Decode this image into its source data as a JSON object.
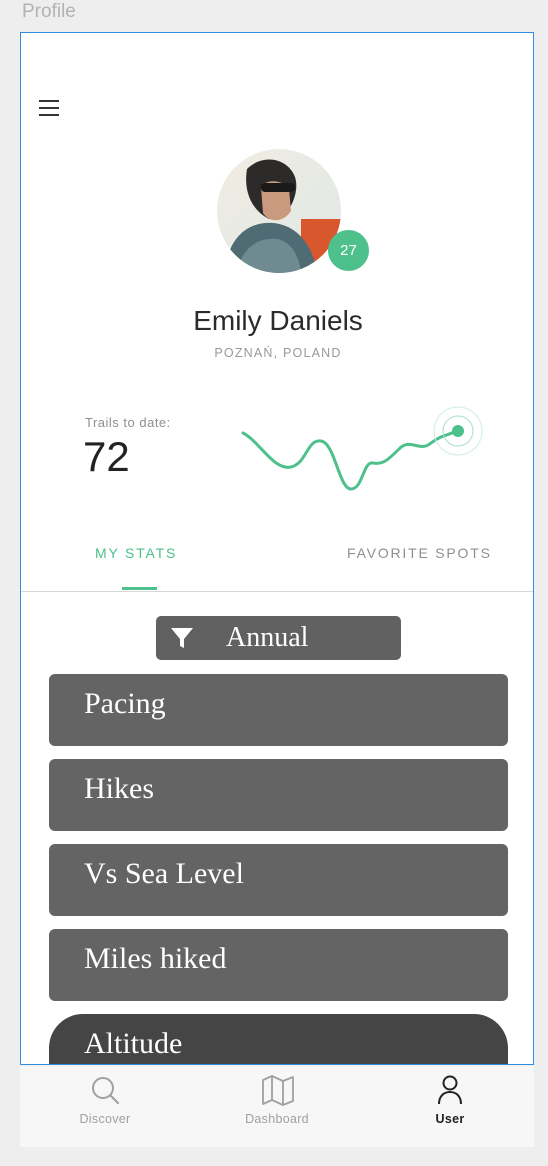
{
  "page_label": "Profile",
  "profile": {
    "name": "Emily Daniels",
    "location": "POZNAŃ, POLAND",
    "badge_count": "27"
  },
  "trails": {
    "label": "Trails to date:",
    "count": "72"
  },
  "tabs": [
    {
      "label": "MY STATS",
      "active": true
    },
    {
      "label": "FAVORITE SPOTS",
      "active": false
    }
  ],
  "filter": {
    "label": "Annual",
    "icon": "filter-icon"
  },
  "stats": [
    {
      "label": "Pacing"
    },
    {
      "label": "Hikes"
    },
    {
      "label": "Vs Sea Level"
    },
    {
      "label": "Miles hiked"
    },
    {
      "label": "Altitude"
    }
  ],
  "bottom_nav": [
    {
      "label": "Discover",
      "icon": "search-icon",
      "active": false
    },
    {
      "label": "Dashboard",
      "icon": "map-icon",
      "active": false
    },
    {
      "label": "User",
      "icon": "user-icon",
      "active": true
    }
  ],
  "colors": {
    "accent": "#4dc08c",
    "frame_border": "#2f8de4",
    "stat_row": "#646464",
    "stat_row_active": "#454545"
  }
}
